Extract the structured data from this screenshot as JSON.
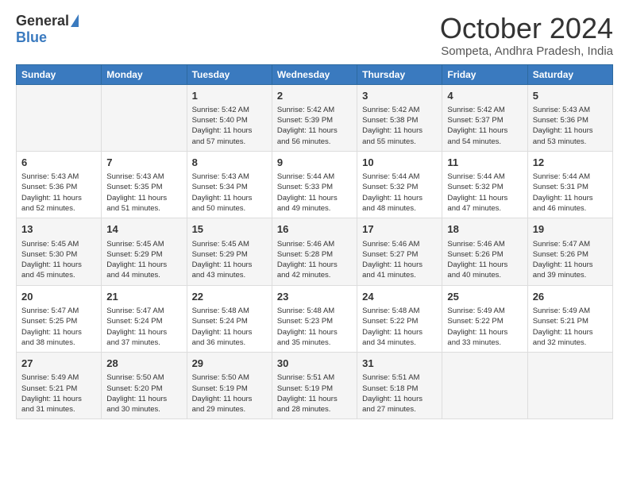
{
  "header": {
    "logo_general": "General",
    "logo_blue": "Blue",
    "month_title": "October 2024",
    "location": "Sompeta, Andhra Pradesh, India"
  },
  "days_of_week": [
    "Sunday",
    "Monday",
    "Tuesday",
    "Wednesday",
    "Thursday",
    "Friday",
    "Saturday"
  ],
  "weeks": [
    {
      "days": [
        {
          "num": "",
          "info": ""
        },
        {
          "num": "",
          "info": ""
        },
        {
          "num": "1",
          "info": "Sunrise: 5:42 AM\nSunset: 5:40 PM\nDaylight: 11 hours and 57 minutes."
        },
        {
          "num": "2",
          "info": "Sunrise: 5:42 AM\nSunset: 5:39 PM\nDaylight: 11 hours and 56 minutes."
        },
        {
          "num": "3",
          "info": "Sunrise: 5:42 AM\nSunset: 5:38 PM\nDaylight: 11 hours and 55 minutes."
        },
        {
          "num": "4",
          "info": "Sunrise: 5:42 AM\nSunset: 5:37 PM\nDaylight: 11 hours and 54 minutes."
        },
        {
          "num": "5",
          "info": "Sunrise: 5:43 AM\nSunset: 5:36 PM\nDaylight: 11 hours and 53 minutes."
        }
      ]
    },
    {
      "days": [
        {
          "num": "6",
          "info": "Sunrise: 5:43 AM\nSunset: 5:36 PM\nDaylight: 11 hours and 52 minutes."
        },
        {
          "num": "7",
          "info": "Sunrise: 5:43 AM\nSunset: 5:35 PM\nDaylight: 11 hours and 51 minutes."
        },
        {
          "num": "8",
          "info": "Sunrise: 5:43 AM\nSunset: 5:34 PM\nDaylight: 11 hours and 50 minutes."
        },
        {
          "num": "9",
          "info": "Sunrise: 5:44 AM\nSunset: 5:33 PM\nDaylight: 11 hours and 49 minutes."
        },
        {
          "num": "10",
          "info": "Sunrise: 5:44 AM\nSunset: 5:32 PM\nDaylight: 11 hours and 48 minutes."
        },
        {
          "num": "11",
          "info": "Sunrise: 5:44 AM\nSunset: 5:32 PM\nDaylight: 11 hours and 47 minutes."
        },
        {
          "num": "12",
          "info": "Sunrise: 5:44 AM\nSunset: 5:31 PM\nDaylight: 11 hours and 46 minutes."
        }
      ]
    },
    {
      "days": [
        {
          "num": "13",
          "info": "Sunrise: 5:45 AM\nSunset: 5:30 PM\nDaylight: 11 hours and 45 minutes."
        },
        {
          "num": "14",
          "info": "Sunrise: 5:45 AM\nSunset: 5:29 PM\nDaylight: 11 hours and 44 minutes."
        },
        {
          "num": "15",
          "info": "Sunrise: 5:45 AM\nSunset: 5:29 PM\nDaylight: 11 hours and 43 minutes."
        },
        {
          "num": "16",
          "info": "Sunrise: 5:46 AM\nSunset: 5:28 PM\nDaylight: 11 hours and 42 minutes."
        },
        {
          "num": "17",
          "info": "Sunrise: 5:46 AM\nSunset: 5:27 PM\nDaylight: 11 hours and 41 minutes."
        },
        {
          "num": "18",
          "info": "Sunrise: 5:46 AM\nSunset: 5:26 PM\nDaylight: 11 hours and 40 minutes."
        },
        {
          "num": "19",
          "info": "Sunrise: 5:47 AM\nSunset: 5:26 PM\nDaylight: 11 hours and 39 minutes."
        }
      ]
    },
    {
      "days": [
        {
          "num": "20",
          "info": "Sunrise: 5:47 AM\nSunset: 5:25 PM\nDaylight: 11 hours and 38 minutes."
        },
        {
          "num": "21",
          "info": "Sunrise: 5:47 AM\nSunset: 5:24 PM\nDaylight: 11 hours and 37 minutes."
        },
        {
          "num": "22",
          "info": "Sunrise: 5:48 AM\nSunset: 5:24 PM\nDaylight: 11 hours and 36 minutes."
        },
        {
          "num": "23",
          "info": "Sunrise: 5:48 AM\nSunset: 5:23 PM\nDaylight: 11 hours and 35 minutes."
        },
        {
          "num": "24",
          "info": "Sunrise: 5:48 AM\nSunset: 5:22 PM\nDaylight: 11 hours and 34 minutes."
        },
        {
          "num": "25",
          "info": "Sunrise: 5:49 AM\nSunset: 5:22 PM\nDaylight: 11 hours and 33 minutes."
        },
        {
          "num": "26",
          "info": "Sunrise: 5:49 AM\nSunset: 5:21 PM\nDaylight: 11 hours and 32 minutes."
        }
      ]
    },
    {
      "days": [
        {
          "num": "27",
          "info": "Sunrise: 5:49 AM\nSunset: 5:21 PM\nDaylight: 11 hours and 31 minutes."
        },
        {
          "num": "28",
          "info": "Sunrise: 5:50 AM\nSunset: 5:20 PM\nDaylight: 11 hours and 30 minutes."
        },
        {
          "num": "29",
          "info": "Sunrise: 5:50 AM\nSunset: 5:19 PM\nDaylight: 11 hours and 29 minutes."
        },
        {
          "num": "30",
          "info": "Sunrise: 5:51 AM\nSunset: 5:19 PM\nDaylight: 11 hours and 28 minutes."
        },
        {
          "num": "31",
          "info": "Sunrise: 5:51 AM\nSunset: 5:18 PM\nDaylight: 11 hours and 27 minutes."
        },
        {
          "num": "",
          "info": ""
        },
        {
          "num": "",
          "info": ""
        }
      ]
    }
  ]
}
